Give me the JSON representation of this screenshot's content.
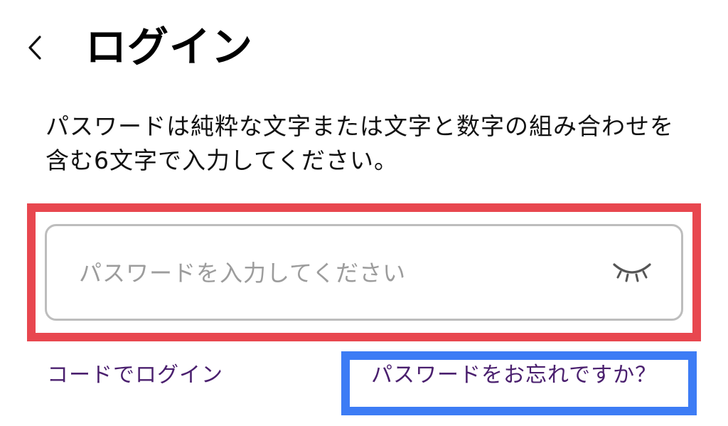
{
  "header": {
    "back_icon": "chevron-left-icon",
    "title": "ログイン"
  },
  "description": "パスワードは純粋な文字または文字と数字の組み合わせを含む6文字で入力してください。",
  "password_field": {
    "placeholder": "パスワードを入力してください",
    "value": "",
    "toggle_icon": "eye-closed-icon"
  },
  "links": {
    "code_login": "コードでログイン",
    "forgot_password": "パスワードをお忘れですか？"
  },
  "annotations": {
    "password_box_color": "#e8474f",
    "forgot_link_box_color": "#3d7cf5"
  },
  "colors": {
    "link": "#4a1f6e",
    "placeholder": "#9c9c9c",
    "field_border": "#bdbdbd"
  }
}
